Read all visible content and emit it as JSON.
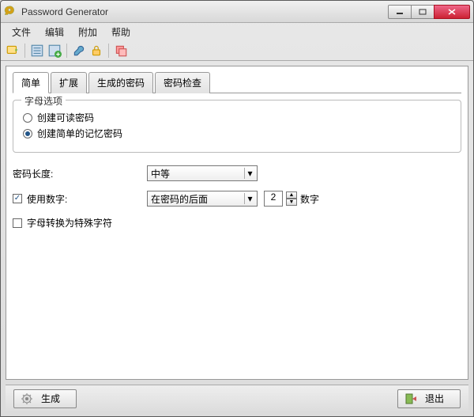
{
  "window": {
    "title": "Password Generator"
  },
  "menu": {
    "file": "文件",
    "edit": "编辑",
    "addon": "附加",
    "help": "帮助"
  },
  "tabs": {
    "simple": "简单",
    "extended": "扩展",
    "generated": "生成的密码",
    "check": "密码检查"
  },
  "fieldset": {
    "legend": "字母选项",
    "radio1": "创建可读密码",
    "radio2": "创建简单的记忆密码"
  },
  "length": {
    "label": "密码长度:",
    "value": "中等"
  },
  "digits": {
    "label": "使用数字:",
    "value": "在密码的后面",
    "count": "2",
    "unit": "数字"
  },
  "special": {
    "label": "字母转换为特殊字符"
  },
  "footer": {
    "generate": "生成",
    "exit": "退出"
  }
}
